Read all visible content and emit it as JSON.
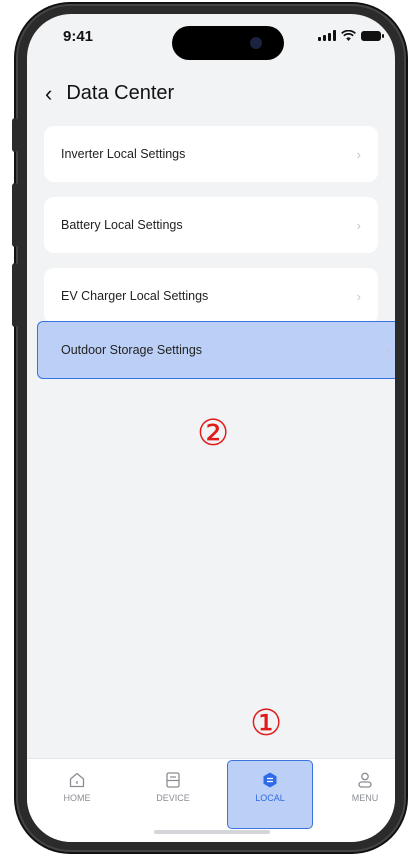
{
  "status_bar": {
    "time": "9:41"
  },
  "header": {
    "back_icon": "‹",
    "title": "Data Center"
  },
  "menu": {
    "items": [
      {
        "label": "Inverter Local Settings"
      },
      {
        "label": "Battery Local Settings"
      },
      {
        "label": "EV Charger Local Settings"
      },
      {
        "label": "Outdoor Storage Settings"
      }
    ],
    "chevron": "›"
  },
  "annotations": {
    "step_1": "①",
    "step_2": "②",
    "color": "#e01b1b"
  },
  "tabbar": {
    "tabs": [
      {
        "label": "HOME",
        "icon": "home-icon"
      },
      {
        "label": "DEVICE",
        "icon": "device-icon"
      },
      {
        "label": "LOCAL",
        "icon": "local-icon"
      },
      {
        "label": "MENU",
        "icon": "menu-user-icon"
      }
    ],
    "active_color": "#2e6be6",
    "highlight_color": "#bcd0f7"
  }
}
